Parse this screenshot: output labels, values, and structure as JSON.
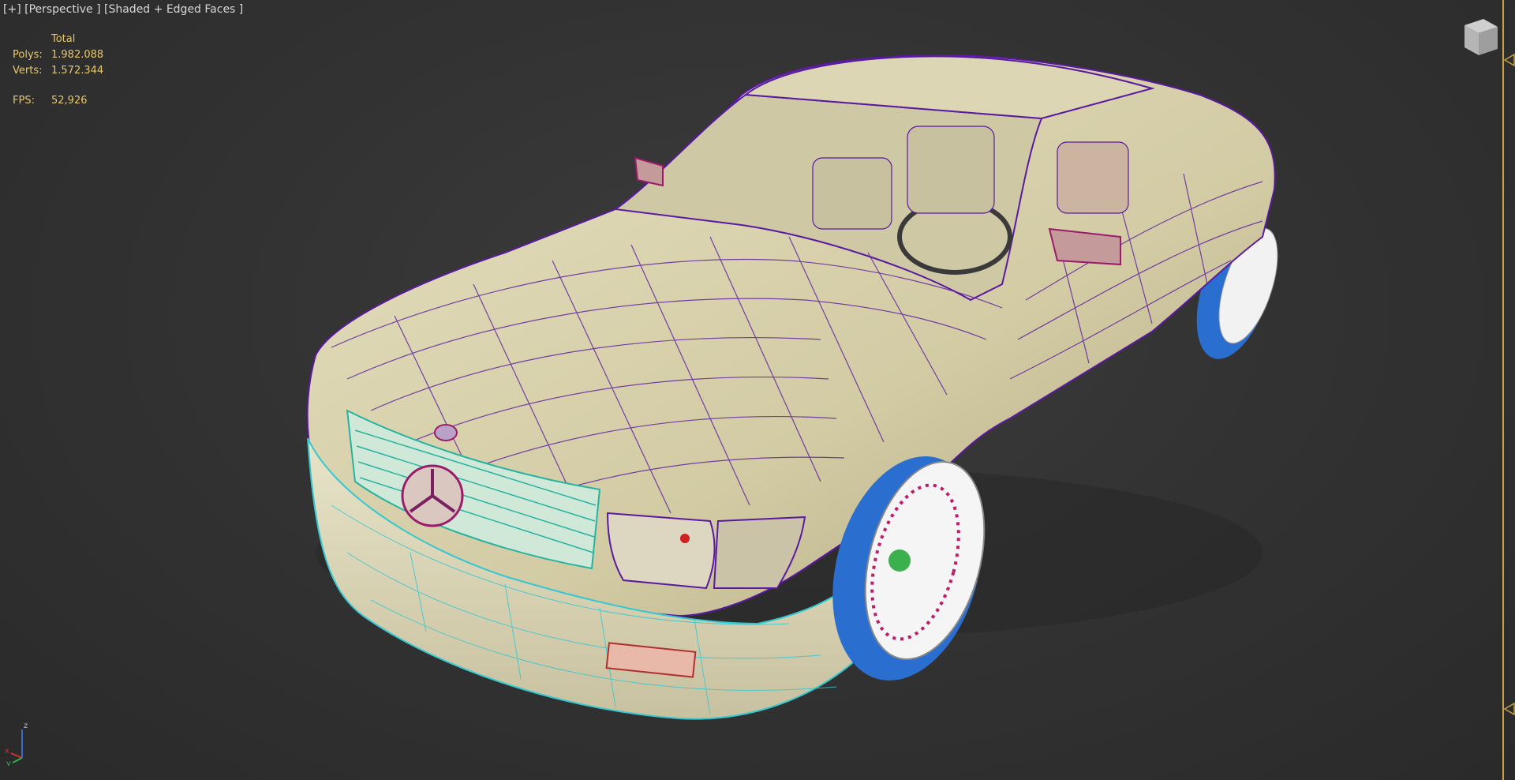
{
  "viewport": {
    "label": "[+] [Perspective ] [Shaded + Edged Faces ]"
  },
  "stats": {
    "header": "Total",
    "polys_label": "Polys:",
    "polys_value": "1.982.088",
    "verts_label": "Verts:",
    "verts_value": "1.572.344",
    "fps_label": "FPS:",
    "fps_value": "52,926"
  },
  "axis": {
    "x": "x",
    "y": "y",
    "z": "z"
  },
  "colors": {
    "background": "#333333",
    "stats_text": "#e8c86a",
    "body_fill": "#d8d2ae",
    "wire_purple": "#5a1aa0",
    "wire_cyan": "#35c7d0",
    "wire_teal": "#27b3a0",
    "tire_blue": "#2a6fd0",
    "timeline_accent": "#c9a24a"
  },
  "icons": [
    "viewcube-icon",
    "axis-gizmo-icon",
    "timeline-marker-icon"
  ]
}
